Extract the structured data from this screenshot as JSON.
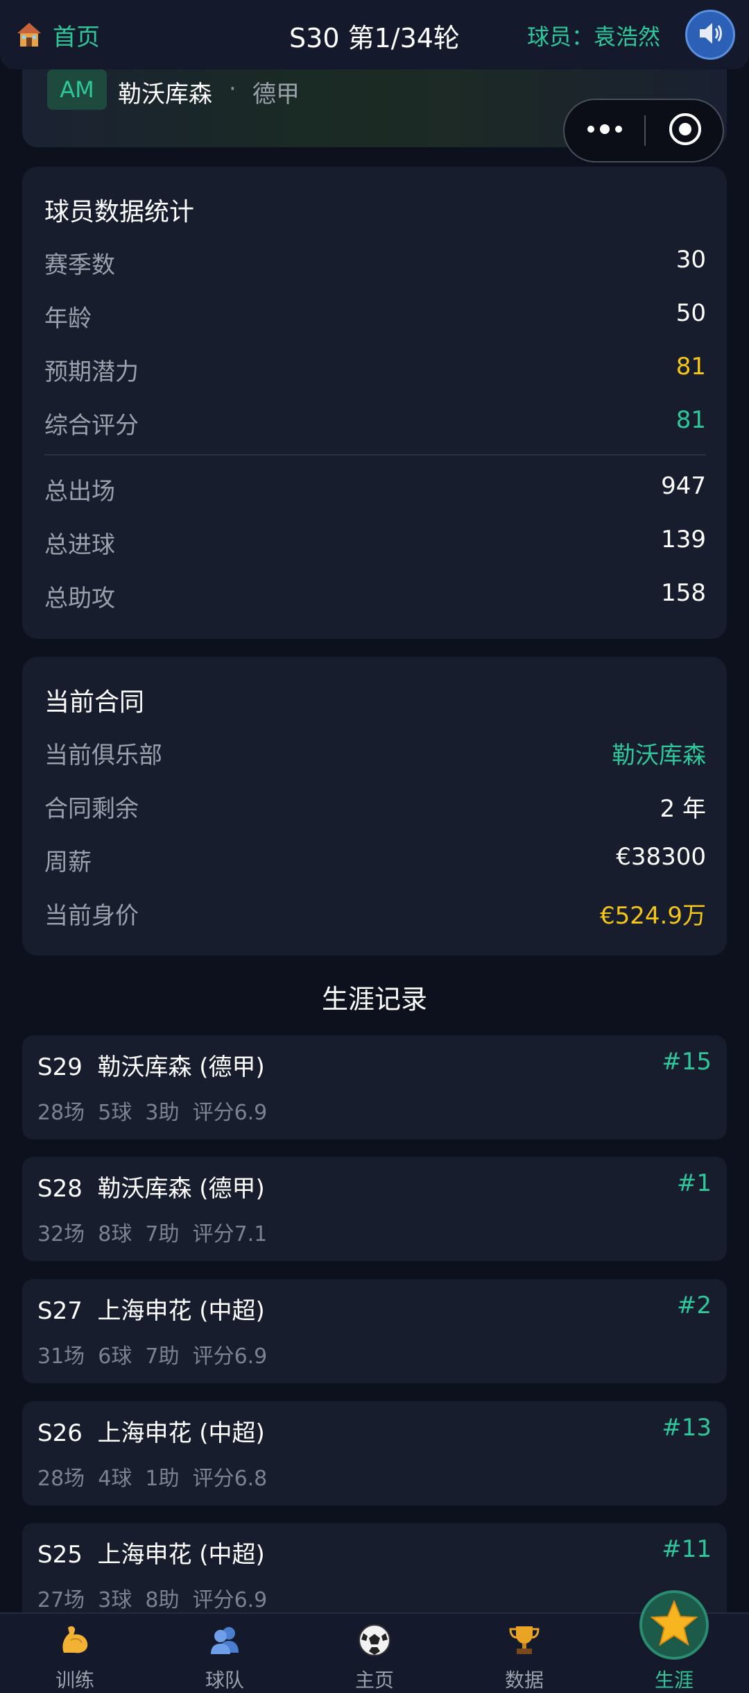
{
  "header": {
    "home_label": "首页",
    "round_title": "S30 第1/34轮",
    "player_prefix": "球员：",
    "player_name": "袁浩然",
    "sound_icon": "speaker-icon"
  },
  "banner": {
    "position": "AM",
    "club": "勒沃库森",
    "separator": "·",
    "league": "德甲"
  },
  "capsule": {
    "menu_icon": "more-dots-icon",
    "close_icon": "target-close-icon"
  },
  "stats": {
    "title": "球员数据统计",
    "rows": [
      {
        "label": "赛季数",
        "value": "30"
      },
      {
        "label": "年龄",
        "value": "50"
      },
      {
        "label": "预期潜力",
        "value": "81"
      },
      {
        "label": "综合评分",
        "value": "81"
      },
      {
        "label": "总出场",
        "value": "947"
      },
      {
        "label": "总进球",
        "value": "139"
      },
      {
        "label": "总助攻",
        "value": "158"
      }
    ]
  },
  "contract": {
    "title": "当前合同",
    "rows": [
      {
        "label": "当前俱乐部",
        "value": "勒沃库森"
      },
      {
        "label": "合同剩余",
        "value": "2 年"
      },
      {
        "label": "周薪",
        "value": "€38300"
      },
      {
        "label": "当前身价",
        "value": "€524.9万"
      }
    ]
  },
  "career": {
    "title": "生涯记录",
    "items": [
      {
        "head": "S29  勒沃库森 (德甲)",
        "rank": "#15",
        "stats": "28场  5球  3助  评分6.9"
      },
      {
        "head": "S28  勒沃库森 (德甲)",
        "rank": "#1",
        "stats": "32场  8球  7助  评分7.1"
      },
      {
        "head": "S27  上海申花 (中超)",
        "rank": "#2",
        "stats": "31场  6球  7助  评分6.9"
      },
      {
        "head": "S26  上海申花 (中超)",
        "rank": "#13",
        "stats": "28场  4球  1助  评分6.8"
      },
      {
        "head": "S25  上海申花 (中超)",
        "rank": "#11",
        "stats": "27场  3球  8助  评分6.9"
      }
    ]
  },
  "nav": {
    "items": [
      {
        "label": "训练",
        "icon": "flexed-biceps-icon"
      },
      {
        "label": "球队",
        "icon": "team-people-icon"
      },
      {
        "label": "主页",
        "icon": "soccer-ball-icon"
      },
      {
        "label": "数据",
        "icon": "trophy-icon"
      },
      {
        "label": "生涯",
        "icon": "star-icon",
        "active": true
      }
    ]
  },
  "colors": {
    "accent_green": "#2fc79a",
    "highlight_yellow": "#f5c518",
    "background": "#0d111e",
    "card": "#181d2e"
  }
}
